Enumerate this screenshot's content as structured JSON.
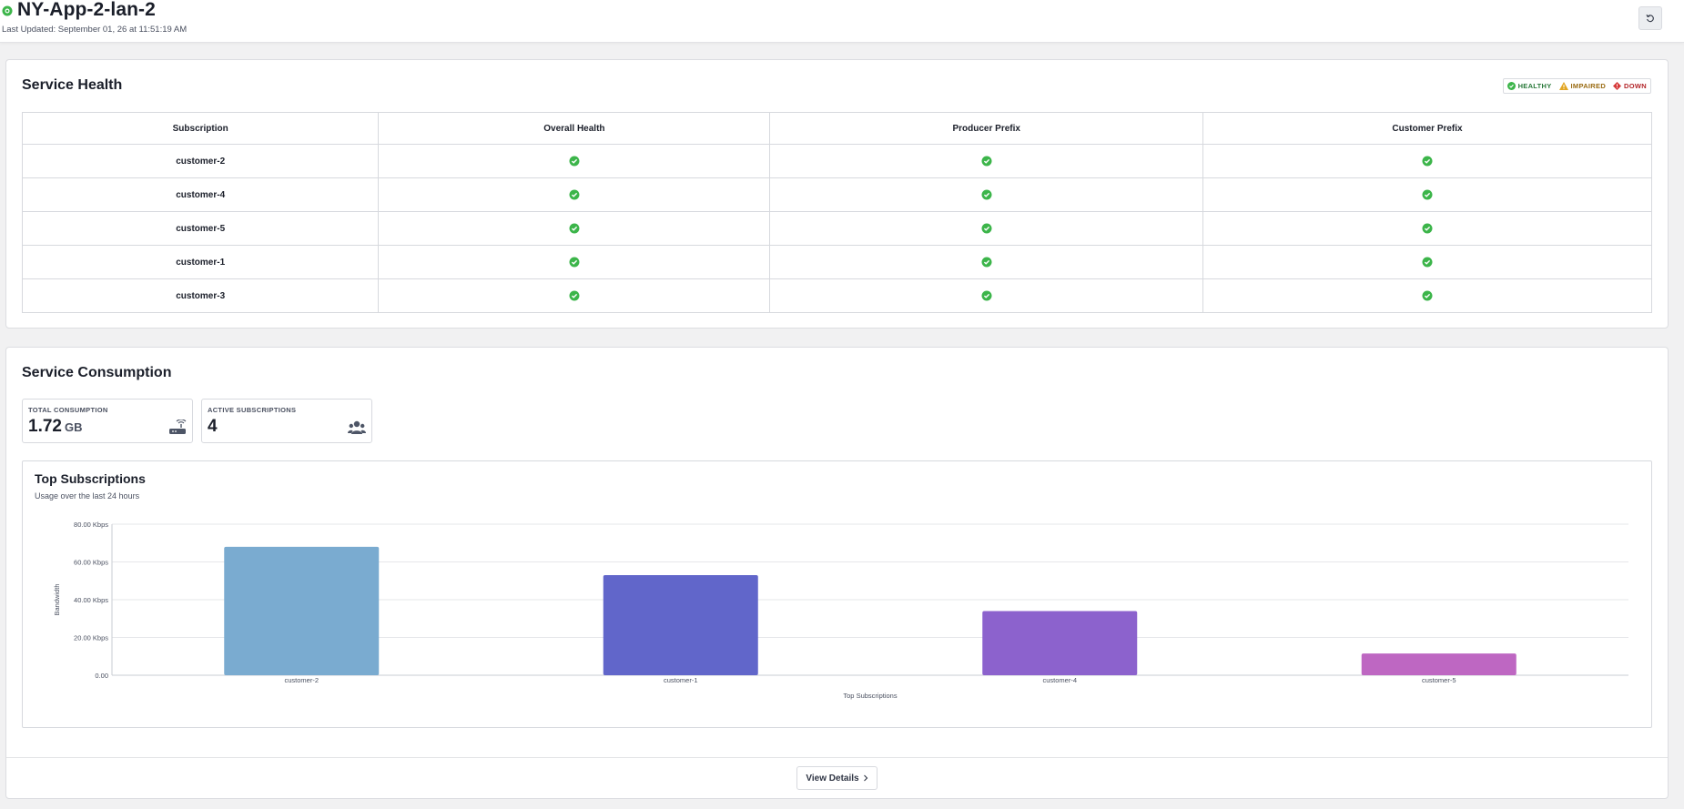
{
  "header": {
    "title": "NY-App-2-lan-2",
    "last_updated": "Last Updated: September 01, 26 at 11:51:19 AM"
  },
  "health": {
    "title": "Service Health",
    "legend": {
      "healthy": "HEALTHY",
      "impaired": "IMPAIRED",
      "down": "DOWN"
    },
    "columns": [
      "Subscription",
      "Overall Health",
      "Producer Prefix",
      "Customer Prefix"
    ],
    "rows": [
      {
        "name": "customer-2",
        "overall": "healthy",
        "producer": "healthy",
        "customer": "healthy"
      },
      {
        "name": "customer-4",
        "overall": "healthy",
        "producer": "healthy",
        "customer": "healthy"
      },
      {
        "name": "customer-5",
        "overall": "healthy",
        "producer": "healthy",
        "customer": "healthy"
      },
      {
        "name": "customer-1",
        "overall": "healthy",
        "producer": "healthy",
        "customer": "healthy"
      },
      {
        "name": "customer-3",
        "overall": "healthy",
        "producer": "healthy",
        "customer": "healthy"
      }
    ],
    "colors": {
      "healthy": "#3cb54a",
      "impaired": "#e2a623",
      "down": "#d63a3a"
    }
  },
  "consumption": {
    "title": "Service Consumption",
    "total": {
      "label": "TOTAL CONSUMPTION",
      "value": "1.72",
      "unit": "GB",
      "icon": "router-icon"
    },
    "active": {
      "label": "ACTIVE SUBSCRIPTIONS",
      "value": "4",
      "icon": "users-icon"
    },
    "view_details": "View Details"
  },
  "chart_data": {
    "type": "bar",
    "title": "Top Subscriptions",
    "subtitle": "Usage over the last 24 hours",
    "categories": [
      "customer-2",
      "customer-1",
      "customer-4",
      "customer-5"
    ],
    "values": [
      68,
      53,
      34,
      11.5
    ],
    "colors": [
      "#7aabd0",
      "#6166ca",
      "#8c62cd",
      "#be67c2"
    ],
    "ylim": [
      0,
      80
    ],
    "yticks": [
      0,
      20,
      40,
      60,
      80
    ],
    "ytick_labels": [
      "0.00",
      "20.00 Kbps",
      "40.00 Kbps",
      "60.00 Kbps",
      "80.00 Kbps"
    ],
    "xlabel": "Top Subscriptions",
    "ylabel": "Bandwidth",
    "grid": true
  }
}
